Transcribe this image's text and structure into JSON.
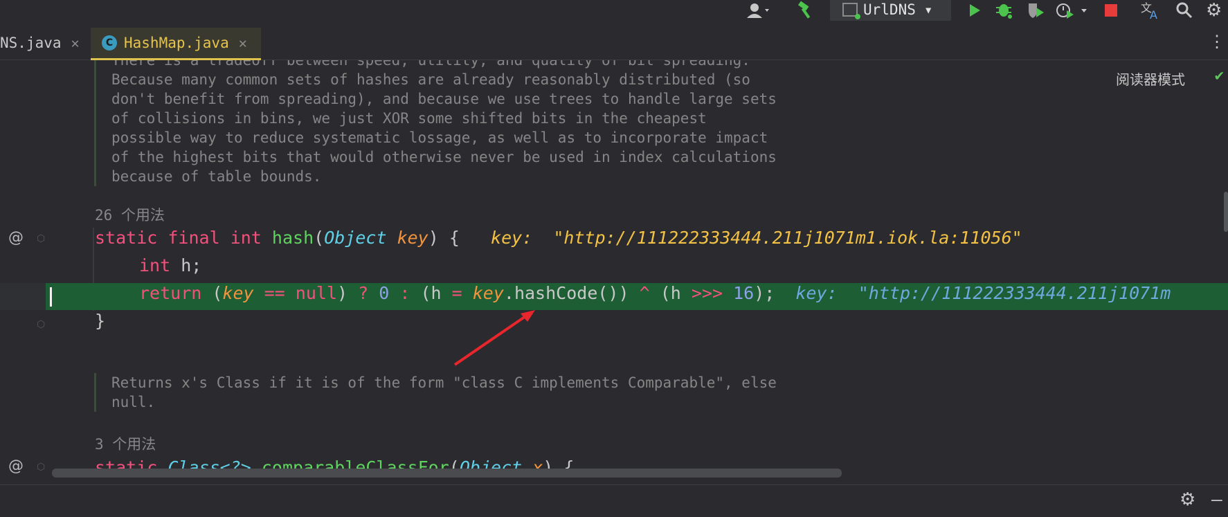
{
  "toolbar": {
    "run_config": "UrlDNS",
    "icons": [
      "user-icon",
      "build-hammer-icon",
      "run-icon",
      "debug-icon",
      "coverage-icon",
      "profile-icon",
      "stop-icon",
      "translate-icon",
      "search-icon",
      "settings-icon"
    ],
    "colors": {
      "run": "#4cc34c",
      "debug": "#4cc34c",
      "stop": "#e83b3b",
      "hammer": "#4cc34c"
    }
  },
  "tabs": [
    {
      "label": "NS.java",
      "active": false
    },
    {
      "label": "HashMap.java",
      "active": true,
      "icon_letter": "C"
    }
  ],
  "editor": {
    "reader_mode": "阅读器模式",
    "doc1_lines": [
      "There is a tradeoff between speed, utility, and quality of bit spreading.",
      "Because many common sets of hashes are already reasonably distributed (so",
      "don't benefit from spreading), and because we use trees to handle large sets",
      "of collisions in bins, we just XOR some shifted bits in the cheapest",
      "possible way to reduce systematic lossage, as well as to incorporate impact",
      "of the highest bits that would otherwise never be used in index calculations",
      "because of table bounds."
    ],
    "usage1": "26 个用法",
    "method_sig": {
      "kw1": "static",
      "kw2": "final",
      "kw3": "int",
      "name": "hash",
      "open": "(",
      "ptype": "Object",
      "pname": "key",
      "close": ") {",
      "hint_label": "key:",
      "hint_value": "\"http://111222333444.211j1071m1.iok.la:11056\""
    },
    "line_int": {
      "kw": "int",
      "rest": " h;"
    },
    "line_return": {
      "kw": "return",
      "p1": " (",
      "key1": "key",
      "eq": " == ",
      "null": "null",
      "p2": ") ",
      "q": "?",
      "sp": " ",
      "zero": "0",
      "colon": " : ",
      "p3": "(h ",
      "assign": "=",
      "sp2": " ",
      "key2": "key",
      "call": ".hashCode()) ",
      "xor": "^",
      "p4": " (h ",
      "shift": ">>>",
      "sp3": " ",
      "sixteen": "16",
      "end": ");",
      "hint_label": "key:",
      "hint_value": "\"http://111222333444.211j1071m"
    },
    "closing_brace": "}",
    "doc2_lines": [
      "Returns x's Class if it is of the form \"class C implements Comparable\", else",
      "null."
    ],
    "usage2": "3 个用法",
    "partial_sig": {
      "kw1": "static",
      "type": "Class<?>",
      "name": "comparableClassFor",
      "open": "(",
      "ptype": "Object",
      "pname": "x",
      "close": ") {"
    },
    "gutter_marks": [
      "@",
      "@"
    ]
  }
}
